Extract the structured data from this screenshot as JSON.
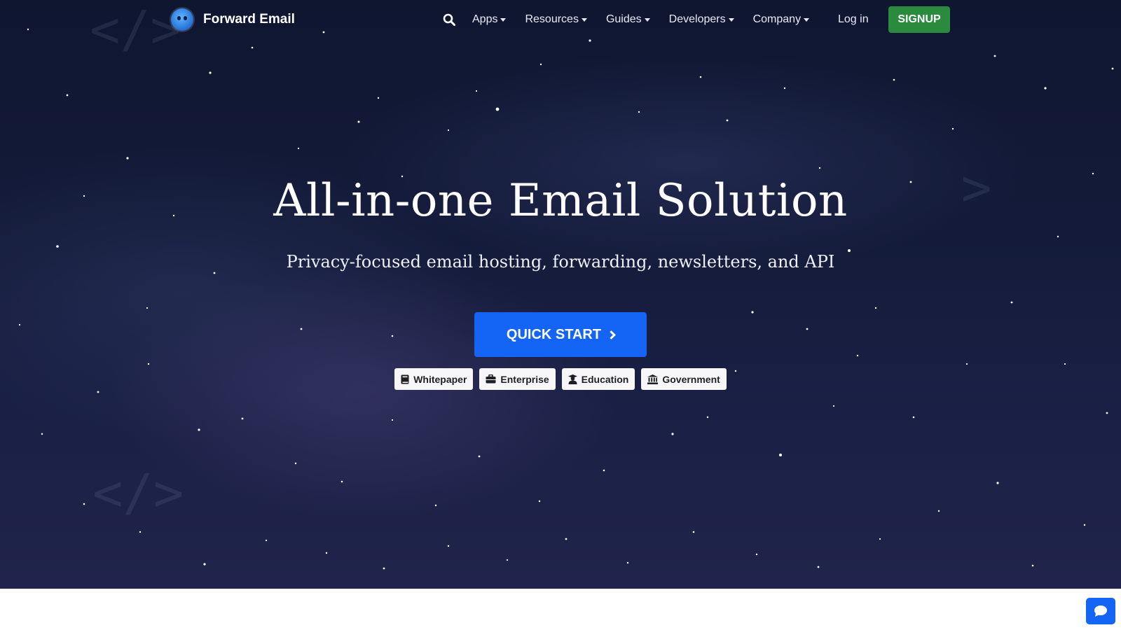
{
  "brand": {
    "name": "Forward Email",
    "logo_icon": "forward-email-logo-icon"
  },
  "nav": {
    "search_icon": "search-icon",
    "items": [
      {
        "label": "Apps"
      },
      {
        "label": "Resources"
      },
      {
        "label": "Guides"
      },
      {
        "label": "Developers"
      },
      {
        "label": "Company"
      }
    ],
    "login_label": "Log in",
    "signup_label": "SIGNUP"
  },
  "hero": {
    "headline": "All-in-one Email Solution",
    "subheadline": "Privacy-focused email hosting, forwarding, newsletters, and API",
    "cta_label": "QUICK START",
    "badges": [
      {
        "label": "Whitepaper",
        "icon": "book-icon"
      },
      {
        "label": "Enterprise",
        "icon": "briefcase-icon"
      },
      {
        "label": "Education",
        "icon": "user-graduate-icon"
      },
      {
        "label": "Government",
        "icon": "landmark-icon"
      }
    ]
  },
  "chat": {
    "icon": "chat-bubble-icon"
  },
  "colors": {
    "hero_background": "#141b3a",
    "signup_green": "#2a8a3e",
    "primary_blue": "#1464f6",
    "badge_background": "#f7f7f9"
  }
}
